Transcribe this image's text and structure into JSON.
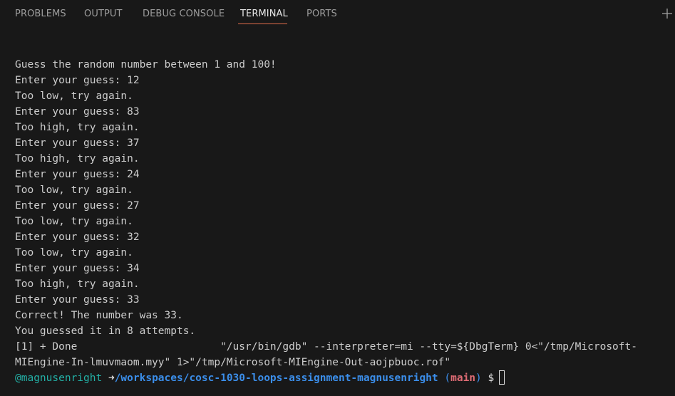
{
  "tabs": [
    {
      "label": "PROBLEMS",
      "active": false
    },
    {
      "label": "OUTPUT",
      "active": false
    },
    {
      "label": "DEBUG CONSOLE",
      "active": false
    },
    {
      "label": "TERMINAL",
      "active": true
    },
    {
      "label": "PORTS",
      "active": false
    }
  ],
  "new_terminal_icon": "plus-icon",
  "terminal": {
    "lines": [
      "Guess the random number between 1 and 100!",
      "Enter your guess: 12",
      "Too low, try again.",
      "Enter your guess: 83",
      "Too high, try again.",
      "Enter your guess: 37",
      "Too high, try again.",
      "Enter your guess: 24",
      "Too low, try again.",
      "Enter your guess: 27",
      "Too low, try again.",
      "Enter your guess: 32",
      "Too low, try again.",
      "Enter your guess: 34",
      "Too high, try again.",
      "Enter your guess: 33",
      "Correct! The number was 33.",
      "You guessed it in 8 attempts.",
      "[1] + Done                       \"/usr/bin/gdb\" --interpreter=mi --tty=${DbgTerm} 0<\"/tmp/Microsoft-",
      "MIEngine-In-lmuvmaom.myy\" 1>\"/tmp/Microsoft-MIEngine-Out-aojpbuoc.rof\""
    ],
    "prompt": {
      "user": "@magnusenright",
      "arrow": "➜",
      "path": "/workspaces/cosc-1030-loops-assignment-magnusenright",
      "paren_open": "(",
      "branch": "main",
      "paren_close": ")",
      "dollar": "$"
    }
  },
  "colors": {
    "background": "#181818",
    "active_tab_underline": "#e06c4b",
    "prompt_user": "#23b0a6",
    "prompt_path": "#3b8eea",
    "prompt_branch": "#e06c75"
  }
}
